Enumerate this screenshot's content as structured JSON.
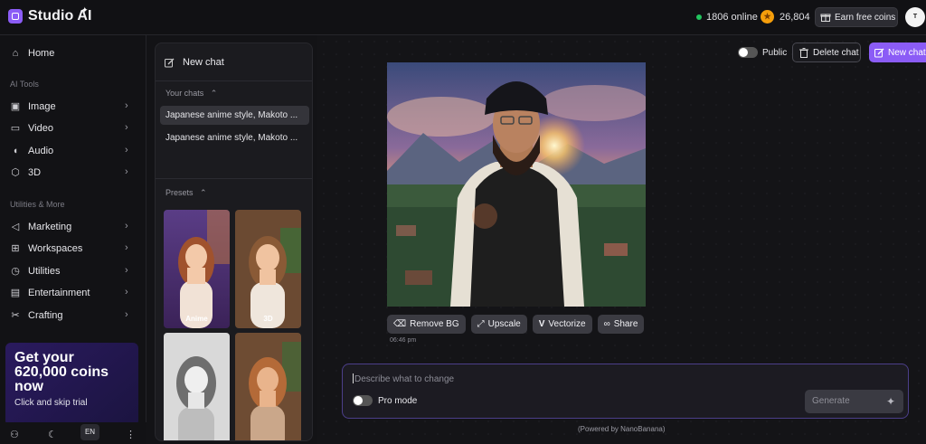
{
  "app": {
    "title": "Studio AI",
    "accent": "#8b5cf6"
  },
  "header": {
    "online_text": "1806 online",
    "coins": "26,804",
    "earn_label": "Earn free coins",
    "avatar_text": "T"
  },
  "sidebar": {
    "home": "Home",
    "ai_tools_label": "AI Tools",
    "ai_tools": [
      {
        "label": "Image",
        "icon": "image-icon"
      },
      {
        "label": "Video",
        "icon": "video-icon"
      },
      {
        "label": "Audio",
        "icon": "audio-icon"
      },
      {
        "label": "3D",
        "icon": "cube-icon"
      }
    ],
    "utilities_label": "Utilities & More",
    "utilities": [
      {
        "label": "Marketing",
        "icon": "megaphone-icon"
      },
      {
        "label": "Workspaces",
        "icon": "grid-icon"
      },
      {
        "label": "Utilities",
        "icon": "clock-icon"
      },
      {
        "label": "Entertainment",
        "icon": "film-icon"
      },
      {
        "label": "Crafting",
        "icon": "scissors-icon"
      }
    ],
    "promo": {
      "title": "Get your 620,000 coins now",
      "subtitle": "Click and skip trial"
    },
    "lang": "EN"
  },
  "chats": {
    "new_chat": "New chat",
    "your_chats_label": "Your chats",
    "items": [
      "Japanese anime style, Makoto ...",
      "Japanese anime style, Makoto ..."
    ],
    "presets_label": "Presets",
    "presets": [
      {
        "label": "Anime"
      },
      {
        "label": "3D"
      },
      {
        "label": ""
      },
      {
        "label": ""
      }
    ]
  },
  "main": {
    "public_label": "Public",
    "delete_label": "Delete chat",
    "new_chat_label": "New chat",
    "actions": [
      "Remove BG",
      "Upscale",
      "Vectorize",
      "Share"
    ],
    "timestamp": "06:46 pm",
    "composer_placeholder": "Describe what to change",
    "pro_mode_label": "Pro mode",
    "generate_label": "Generate",
    "powered_by": "(Powered by NanoBanana)"
  }
}
